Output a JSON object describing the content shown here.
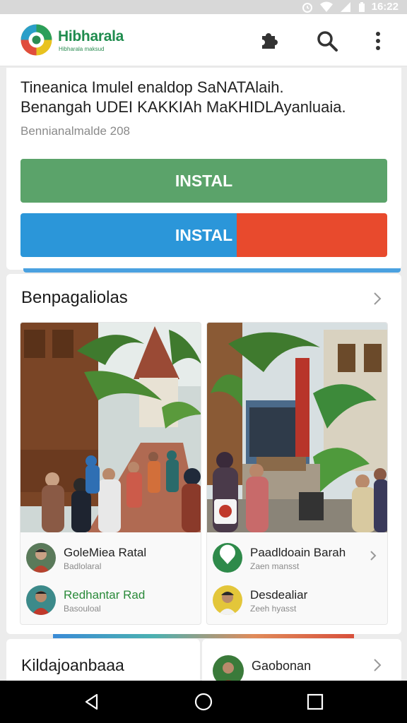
{
  "status_bar": {
    "time": "16:22"
  },
  "app_bar": {
    "brand_name": "Hibharala",
    "brand_tagline": "Hibharala maksud",
    "icons": [
      "puzzle-icon",
      "search-icon",
      "more-vert-icon"
    ]
  },
  "hero": {
    "title_line1": "Tineanica Imulel enaldop SaNATAlaih.",
    "title_line2": "Benangah UDEI KAKKIAh MaKHIDLAyanluaia.",
    "meta": "Bennianalmalde 208",
    "primary_button": "INSTAL",
    "secondary_button": "INSTAL"
  },
  "section": {
    "title": "Benpagaliolas",
    "tiles": [
      {
        "rows": [
          {
            "title": "GoleMiea Ratal",
            "subtitle": "Badlolaral",
            "title_color": "default"
          },
          {
            "title": "Redhantar Rad",
            "subtitle": "Basouloal",
            "title_color": "green"
          }
        ]
      },
      {
        "rows": [
          {
            "title": "Paadldoain Barah",
            "subtitle": "Zaen mansst",
            "title_color": "default"
          },
          {
            "title": "Desdealiar",
            "subtitle": "Zeeh hyasst",
            "title_color": "default"
          }
        ]
      }
    ]
  },
  "bottom": {
    "left_title": "Kildajoanbaaa",
    "right_label": "Gaobonan"
  },
  "colors": {
    "primary_green": "#5ba36a",
    "split_blue": "#2b96d9",
    "split_red": "#e84a2d",
    "brand_green": "#1f8c4e"
  },
  "nav_bar": {
    "icons": [
      "back-icon",
      "home-icon",
      "recents-icon"
    ]
  }
}
